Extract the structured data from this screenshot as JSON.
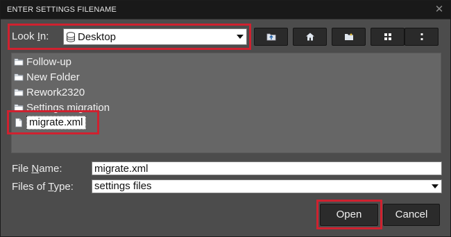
{
  "dialog": {
    "title": "ENTER SETTINGS FILENAME",
    "close_icon": "close-icon"
  },
  "look_in": {
    "label_prefix": "Look ",
    "label_mnemonic": "I",
    "label_suffix": "n:",
    "value": "Desktop",
    "icon": "drive-icon"
  },
  "toolbar": {
    "buttons": [
      {
        "name": "up-one-level-button",
        "icon": "folder-up-icon"
      },
      {
        "name": "home-button",
        "icon": "home-icon"
      },
      {
        "name": "new-folder-button",
        "icon": "new-folder-icon"
      },
      {
        "name": "list-view-button",
        "icon": "list-view-icon"
      },
      {
        "name": "details-view-button",
        "icon": "details-view-icon"
      }
    ]
  },
  "files": [
    {
      "name": "Follow-up",
      "type": "folder",
      "selected": false
    },
    {
      "name": "New Folder",
      "type": "folder",
      "selected": false
    },
    {
      "name": "Rework2320",
      "type": "folder",
      "selected": false
    },
    {
      "name": "Settings migration",
      "type": "folder",
      "selected": false
    },
    {
      "name": "migrate.xml",
      "type": "file",
      "selected": true
    }
  ],
  "file_name": {
    "label_prefix": "File ",
    "label_mnemonic": "N",
    "label_suffix": "ame:",
    "value": "migrate.xml"
  },
  "file_type": {
    "label_prefix": "Files of ",
    "label_mnemonic": "T",
    "label_suffix": "ype:",
    "value": "settings files"
  },
  "buttons": {
    "open_label": "Open",
    "cancel_label": "Cancel"
  },
  "colors": {
    "highlight": "#d0212f",
    "titlebar": "#191919",
    "dialog_bg": "#4c4c4c",
    "list_bg": "#666666"
  }
}
